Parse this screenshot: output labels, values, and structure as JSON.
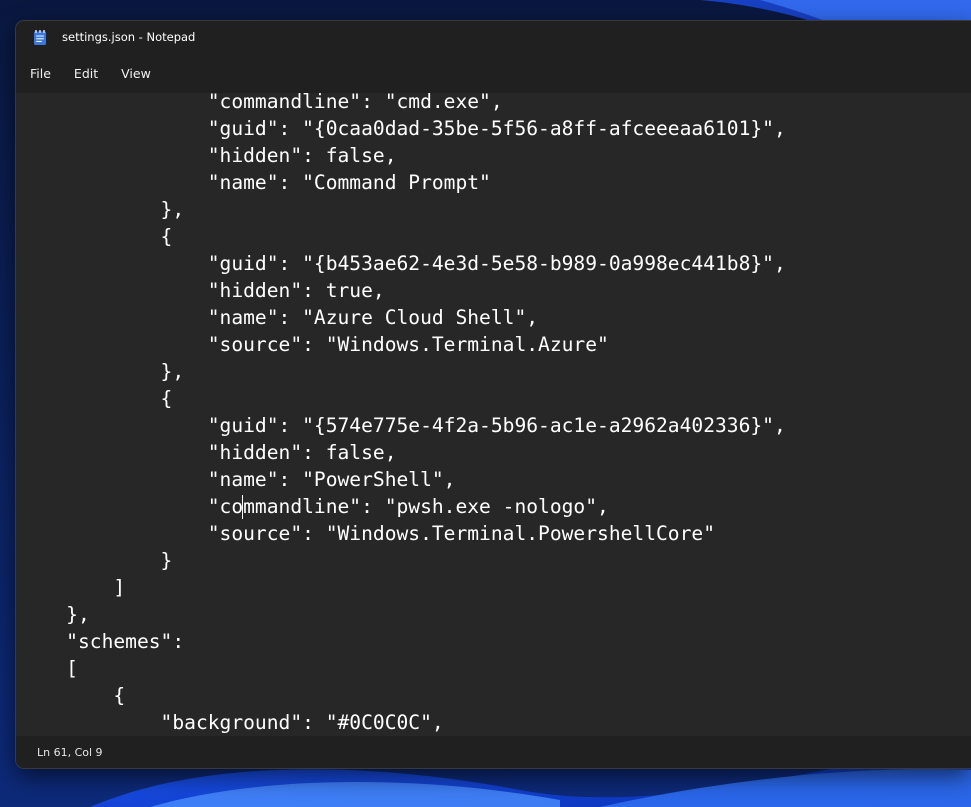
{
  "window": {
    "title": "settings.json - Notepad"
  },
  "menu": {
    "items": [
      "File",
      "Edit",
      "View"
    ]
  },
  "editor": {
    "lines": [
      "                \"commandline\": \"cmd.exe\",",
      "                \"guid\": \"{0caa0dad-35be-5f56-a8ff-afceeeaa6101}\",",
      "                \"hidden\": false,",
      "                \"name\": \"Command Prompt\"",
      "            },",
      "            {",
      "                \"guid\": \"{b453ae62-4e3d-5e58-b989-0a998ec441b8}\",",
      "                \"hidden\": true,",
      "                \"name\": \"Azure Cloud Shell\",",
      "                \"source\": \"Windows.Terminal.Azure\"",
      "            },",
      "            {",
      "                \"guid\": \"{574e775e-4f2a-5b96-ac1e-a2962a402336}\",",
      "                \"hidden\": false,",
      "                \"name\": \"PowerShell\",",
      "                \"commandline\": \"pwsh.exe -nologo\",",
      "                \"source\": \"Windows.Terminal.PowershellCore\"",
      "            }",
      "        ]",
      "    },",
      "    \"schemes\":",
      "    [",
      "        {",
      "            \"background\": \"#0C0C0C\","
    ],
    "caret_line_index": 15
  },
  "status": {
    "position": "Ln 61, Col 9"
  },
  "colors": {
    "editor_bg": "#272727",
    "chrome_bg": "#202020",
    "text": "#ffffff",
    "accent": "#3b78d8"
  },
  "icons": {
    "app_icon": "notepad-icon"
  }
}
